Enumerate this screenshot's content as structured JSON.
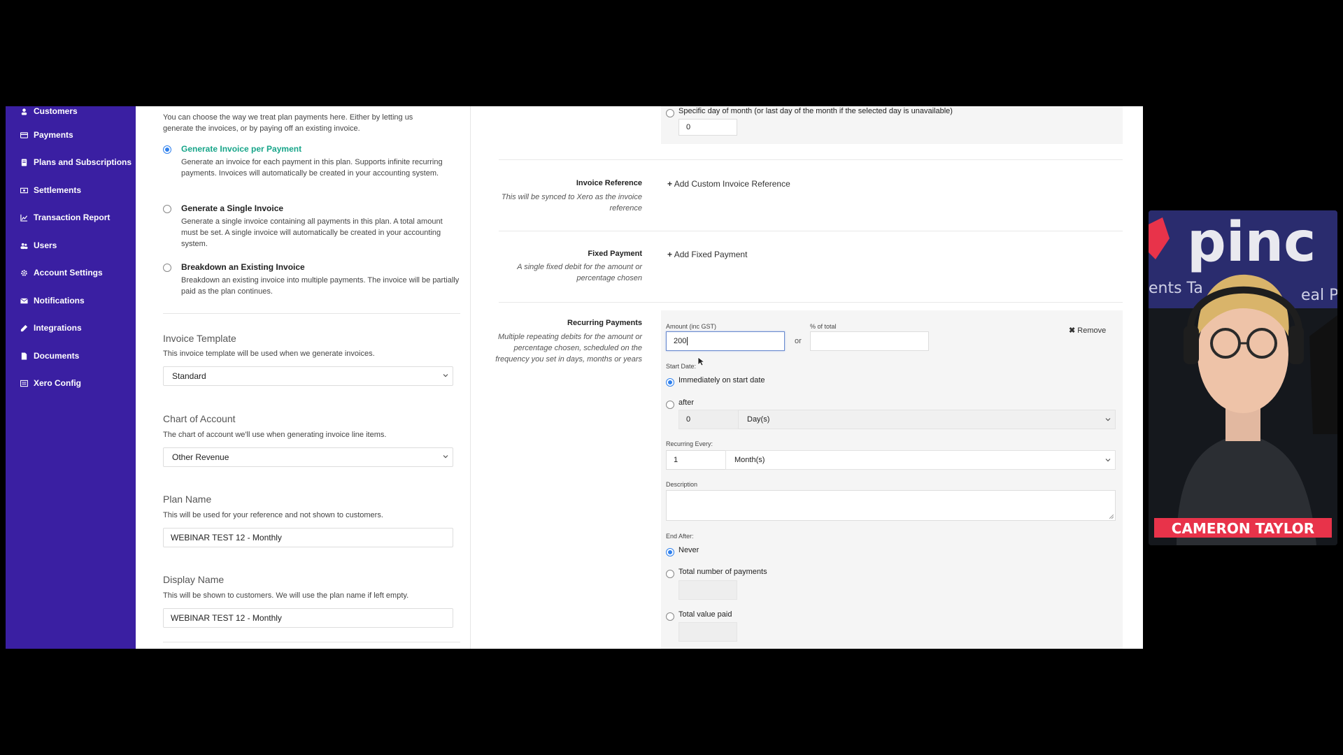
{
  "sidebar": {
    "items": [
      {
        "label": "Customers",
        "icon": "customers-icon"
      },
      {
        "label": "Payments",
        "icon": "card-icon"
      },
      {
        "label": "Plans and Subscriptions",
        "icon": "document-icon"
      },
      {
        "label": "Settlements",
        "icon": "money-icon"
      },
      {
        "label": "Transaction Report",
        "icon": "chart-icon"
      },
      {
        "label": "Users",
        "icon": "users-icon"
      },
      {
        "label": "Account Settings",
        "icon": "gear-icon"
      },
      {
        "label": "Notifications",
        "icon": "envelope-icon"
      },
      {
        "label": "Integrations",
        "icon": "pencil-icon"
      },
      {
        "label": "Documents",
        "icon": "file-icon"
      },
      {
        "label": "Xero Config",
        "icon": "list-icon"
      }
    ]
  },
  "invoice_options": {
    "intro": "You can choose the way we treat plan payments here. Either by letting us generate the invoices, or by paying off an existing invoice.",
    "options": [
      {
        "title": "Generate Invoice per Payment",
        "desc": "Generate an invoice for each payment in this plan. Supports infinite recurring payments. Invoices will automatically be created in your accounting system.",
        "selected": true
      },
      {
        "title": "Generate a Single Invoice",
        "desc": "Generate a single invoice containing all payments in this plan. A total amount must be set. A single invoice will automatically be created in your accounting system.",
        "selected": false
      },
      {
        "title": "Breakdown an Existing Invoice",
        "desc": "Breakdown an existing invoice into multiple payments. The invoice will be partially paid as the plan continues.",
        "selected": false
      }
    ]
  },
  "invoice_template": {
    "title": "Invoice Template",
    "desc": "This invoice template will be used when we generate invoices.",
    "value": "Standard"
  },
  "chart_of_account": {
    "title": "Chart of Account",
    "desc": "The chart of account we'll use when generating invoice line items.",
    "value": "Other Revenue"
  },
  "plan_name": {
    "title": "Plan Name",
    "desc": "This will be used for your reference and not shown to customers.",
    "value": "WEBINAR TEST 12 - Monthly"
  },
  "display_name": {
    "title": "Display Name",
    "desc": "This will be shown to customers. We will use the plan name if left empty.",
    "value": "WEBINAR TEST 12 - Monthly"
  },
  "specific_day": {
    "label": "Specific day of month (or last day of the month if the selected day is unavailable)",
    "value": "0"
  },
  "invoice_reference": {
    "title": "Invoice Reference",
    "desc": "This will be synced to Xero as the invoice reference",
    "action": "Add Custom Invoice Reference"
  },
  "fixed_payment": {
    "title": "Fixed Payment",
    "desc": "A single fixed debit for the amount or percentage chosen",
    "action": "Add Fixed Payment"
  },
  "recurring": {
    "title": "Recurring Payments",
    "desc": "Multiple repeating debits for the amount or percentage chosen, scheduled on the frequency you set in days, months or years",
    "amount_label": "Amount (inc GST)",
    "amount_value": "200",
    "or_label": "or",
    "percent_label": "% of total",
    "percent_value": "",
    "remove_label": "Remove",
    "start_date_label": "Start Date:",
    "start_immediately": "Immediately on start date",
    "start_after": "after",
    "after_value": "0",
    "after_unit": "Day(s)",
    "recurring_every_label": "Recurring Every:",
    "every_value": "1",
    "every_unit": "Month(s)",
    "description_label": "Description",
    "description_value": "",
    "end_after_label": "End After:",
    "end_never": "Never",
    "end_total_payments": "Total number of payments",
    "end_total_value": "Total value paid"
  },
  "webcam": {
    "name": "CAMERON TAYLOR",
    "bg_text": "pinc",
    "bg_sub_left": "ents Ta",
    "bg_sub_right": "eal P",
    "accent": "#e8334a"
  },
  "colors": {
    "sidebar": "#3a1fa2",
    "accent_green": "#17a589",
    "radio_blue": "#2f80ed"
  }
}
